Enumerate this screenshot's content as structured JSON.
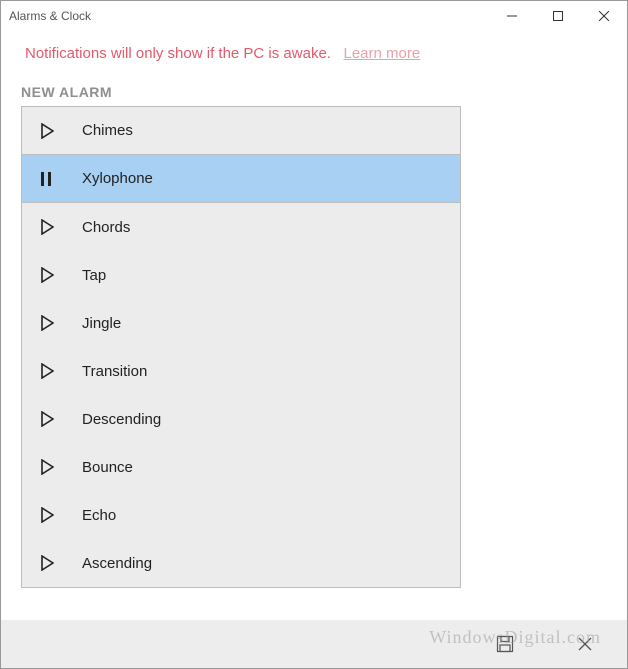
{
  "window": {
    "title": "Alarms & Clock"
  },
  "notice": {
    "text": "Notifications will only show if the PC is awake.",
    "link_label": "Learn more"
  },
  "section": {
    "label": "NEW ALARM"
  },
  "sounds": {
    "items": [
      {
        "name": "Chimes",
        "playing": false
      },
      {
        "name": "Xylophone",
        "playing": true
      },
      {
        "name": "Chords",
        "playing": false
      },
      {
        "name": "Tap",
        "playing": false
      },
      {
        "name": "Jingle",
        "playing": false
      },
      {
        "name": "Transition",
        "playing": false
      },
      {
        "name": "Descending",
        "playing": false
      },
      {
        "name": "Bounce",
        "playing": false
      },
      {
        "name": "Echo",
        "playing": false
      },
      {
        "name": "Ascending",
        "playing": false
      }
    ],
    "selected_index": 1
  },
  "icons": {
    "play": "play-icon",
    "pause": "pause-icon",
    "save": "save-icon",
    "cancel": "cancel-icon",
    "minimize": "minimize-icon",
    "maximize": "maximize-icon",
    "close": "close-icon"
  },
  "watermark": "WindowsDigital.com"
}
